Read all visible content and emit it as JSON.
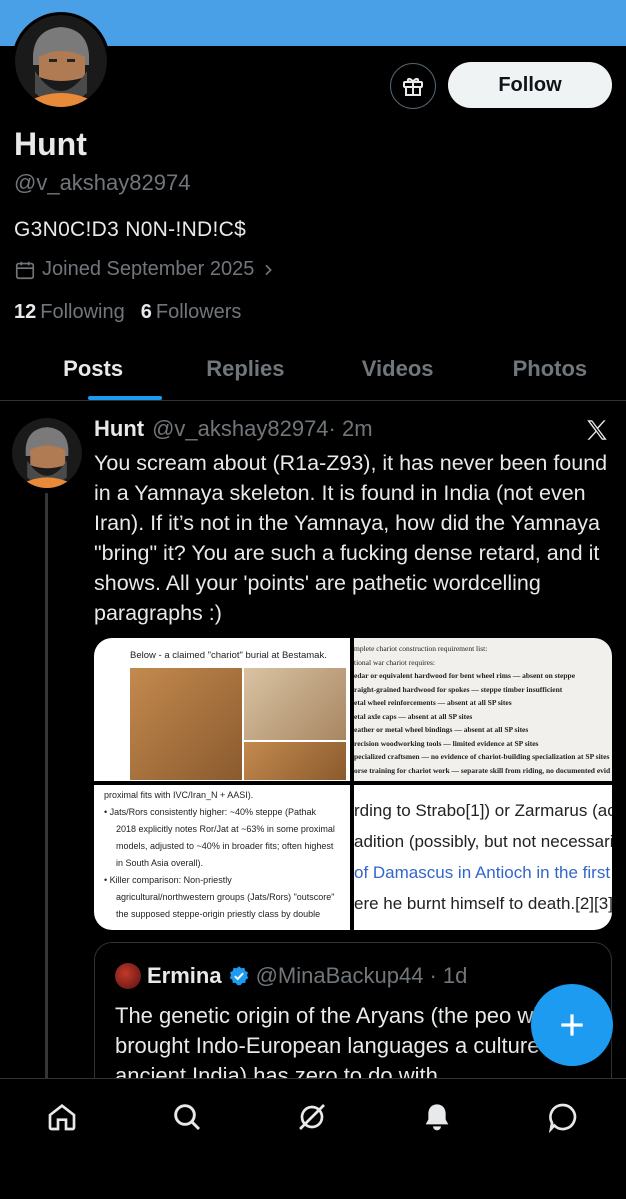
{
  "profile": {
    "name": "Hunt",
    "handle": "@v_akshay82974",
    "bio": "G3N0C!D3 N0N-!ND!C$",
    "joined": "Joined September 2025",
    "following_count": "12",
    "following_label": "Following",
    "followers_count": "6",
    "followers_label": "Followers",
    "follow_label": "Follow"
  },
  "tabs": [
    {
      "label": "Posts",
      "active": true
    },
    {
      "label": "Replies"
    },
    {
      "label": "Videos"
    },
    {
      "label": "Photos"
    }
  ],
  "post": {
    "author": "Hunt",
    "handle": "@v_akshay82974",
    "time": "· 2m",
    "text": "You scream about (R1a-Z93), it has never been found in a Yamnaya skeleton. It is found in India (not even Iran). If it’s not in the Yamnaya, how did the Yamnaya \"bring\" it? You are such a fucking dense retard, and it shows. All your 'points' are pathetic wordcelling paragraphs :)"
  },
  "media": {
    "img1_caption": "Below - a claimed \"chariot\" burial at Bestamak.",
    "img2_lines": [
      "mplete chariot construction requirement list:",
      "tional war chariot requires:",
      "edar or equivalent hardwood for bent wheel rims — absent on steppe",
      "raight-grained hardwood for spokes — steppe timber insufficient",
      "etal wheel reinforcements — absent at all SP sites",
      "etal axle caps — absent at all SP sites",
      "eather or metal wheel bindings — absent at all SP sites",
      "recision woodworking tools — limited evidence at SP sites",
      "pecialized craftsmen — no evidence of chariot-building specialization at SP sites",
      "orse training for chariot work — separate skill from riding, no documented evid"
    ],
    "img3_lines": [
      "proximal fits with IVC/Iran_N + AASI).",
      "• Jats/Rors consistently higher: ~40% steppe (Pathak",
      "2018 explicitly notes Ror/Jat at ~63% in some proximal",
      "models, adjusted to ~40% in broader fits; often highest",
      "in South Asia overall).",
      "• Killer comparison: Non-priestly",
      "agricultural/northwestern groups (Jats/Rors) \"outscore\"",
      "the supposed steppe-origin priestly class by double"
    ],
    "img4_lines": [
      "rding to Strabo[1]) or Zarmarus (ac",
      "adition (possibly, but not necessaril",
      "of Damascus in Antioch in the first",
      "ere he burnt himself to death.[2][3] H"
    ]
  },
  "quote": {
    "name": "Ermina",
    "handle": "@MinaBackup44",
    "time": "· 1d",
    "text": "The genetic origin of the Aryans (the peo who brought Indo-European languages a culture into ancient India) has zero to do with"
  },
  "colors": {
    "banner": "#4aa0e6",
    "accent": "#1d9bf0",
    "muted": "#71767b"
  },
  "icons": [
    "gift-icon",
    "calendar-icon",
    "chevron-right-icon",
    "x-logo-icon",
    "verified-badge-icon",
    "plus-icon",
    "home-icon",
    "search-icon",
    "grok-icon",
    "bell-icon",
    "messages-icon"
  ]
}
